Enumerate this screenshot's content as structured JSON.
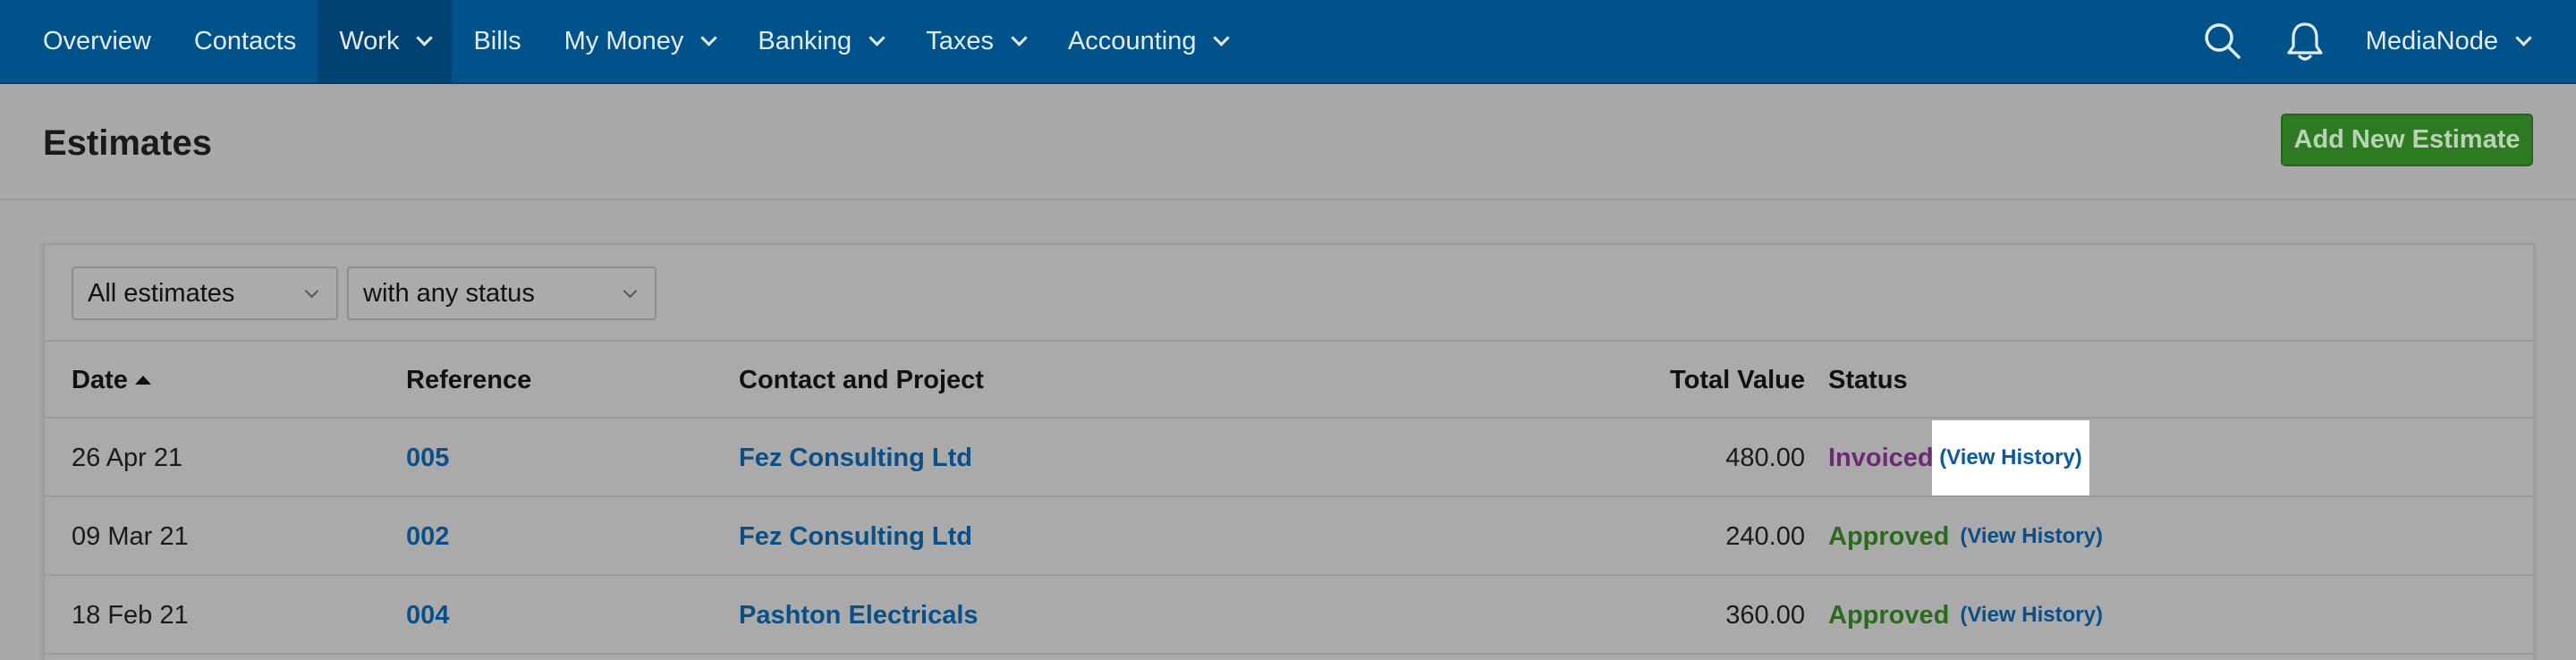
{
  "nav": {
    "items": [
      {
        "label": "Overview",
        "dropdown": false
      },
      {
        "label": "Contacts",
        "dropdown": false
      },
      {
        "label": "Work",
        "dropdown": true,
        "active": true
      },
      {
        "label": "Bills",
        "dropdown": false
      },
      {
        "label": "My Money",
        "dropdown": true
      },
      {
        "label": "Banking",
        "dropdown": true
      },
      {
        "label": "Taxes",
        "dropdown": true
      },
      {
        "label": "Accounting",
        "dropdown": true
      }
    ],
    "search_icon": "search-icon",
    "notifications_icon": "bell-icon",
    "account_label": "MediaNode"
  },
  "page": {
    "title": "Estimates",
    "add_button": "Add New Estimate"
  },
  "filters": {
    "type_value": "All estimates",
    "status_value": "with any status"
  },
  "table": {
    "headers": {
      "date": "Date",
      "reference": "Reference",
      "contact": "Contact and Project",
      "total": "Total Value",
      "status": "Status"
    },
    "sorted_by": "date",
    "sort_direction": "ascending",
    "view_history_label": "(View History)",
    "rows": [
      {
        "date": "26 Apr 21",
        "reference": "005",
        "contact": "Fez Consulting Ltd",
        "total": "480.00",
        "status": "Invoiced"
      },
      {
        "date": "09 Mar 21",
        "reference": "002",
        "contact": "Fez Consulting Ltd",
        "total": "240.00",
        "status": "Approved"
      },
      {
        "date": "18 Feb 21",
        "reference": "004",
        "contact": "Pashton Electricals",
        "total": "360.00",
        "status": "Approved"
      }
    ]
  },
  "colors": {
    "nav_bg": "#00528a",
    "add_button": "#2d7a22",
    "link": "#0b4f86",
    "status_invoiced": "#6a2b70",
    "status_approved": "#2b6a1c"
  }
}
